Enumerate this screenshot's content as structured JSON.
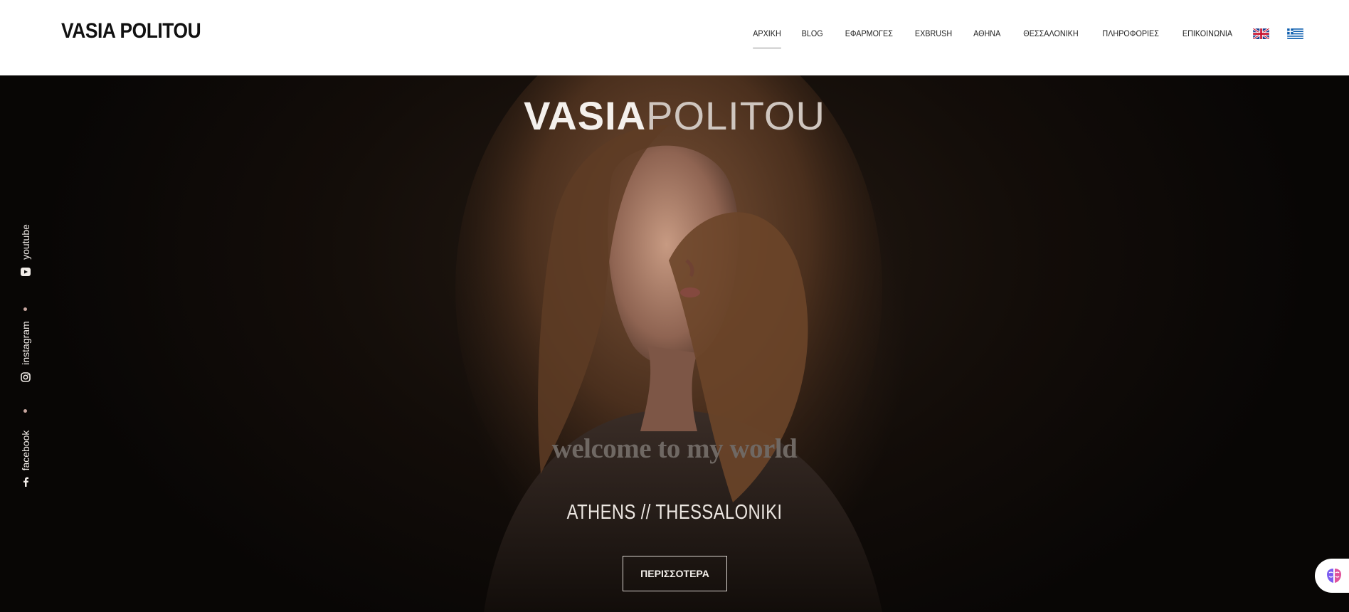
{
  "header": {
    "logo": "VASIA POLITOU",
    "nav": [
      {
        "label": "ΑΡΧΙΚΗ",
        "active": true
      },
      {
        "label": "BLOG",
        "active": false
      },
      {
        "label": "ΕΦΑΡΜΟΓΕΣ",
        "active": false
      },
      {
        "label": "EXBRUSH",
        "active": false
      },
      {
        "label": "ΑΘΗΝΑ",
        "active": false
      },
      {
        "label": "ΘΕΣΣΑΛΟΝΙΚΗ",
        "active": false
      },
      {
        "label": "ΠΛΗΡΟΦΟΡΙΕΣ",
        "active": false
      },
      {
        "label": "ΕΠΙΚΟΙΝΩΝΙΑ",
        "active": false
      }
    ],
    "flags": [
      "uk-flag-icon",
      "greek-flag-icon"
    ]
  },
  "hero": {
    "logo_bold": "VASIA",
    "logo_light": "POLITOU",
    "tagline": "welcome to my world",
    "cities": "ATHENS // THESSALONIKI",
    "button_label": "ΠΕΡΙΣΣΟΤΕΡΑ"
  },
  "social": {
    "youtube": "youtube",
    "instagram": "instagram",
    "facebook": "facebook"
  },
  "colors": {
    "header_bg": "#ffffff",
    "hero_bg": "#0b0806",
    "accent_dot": "#c9a7a0"
  }
}
